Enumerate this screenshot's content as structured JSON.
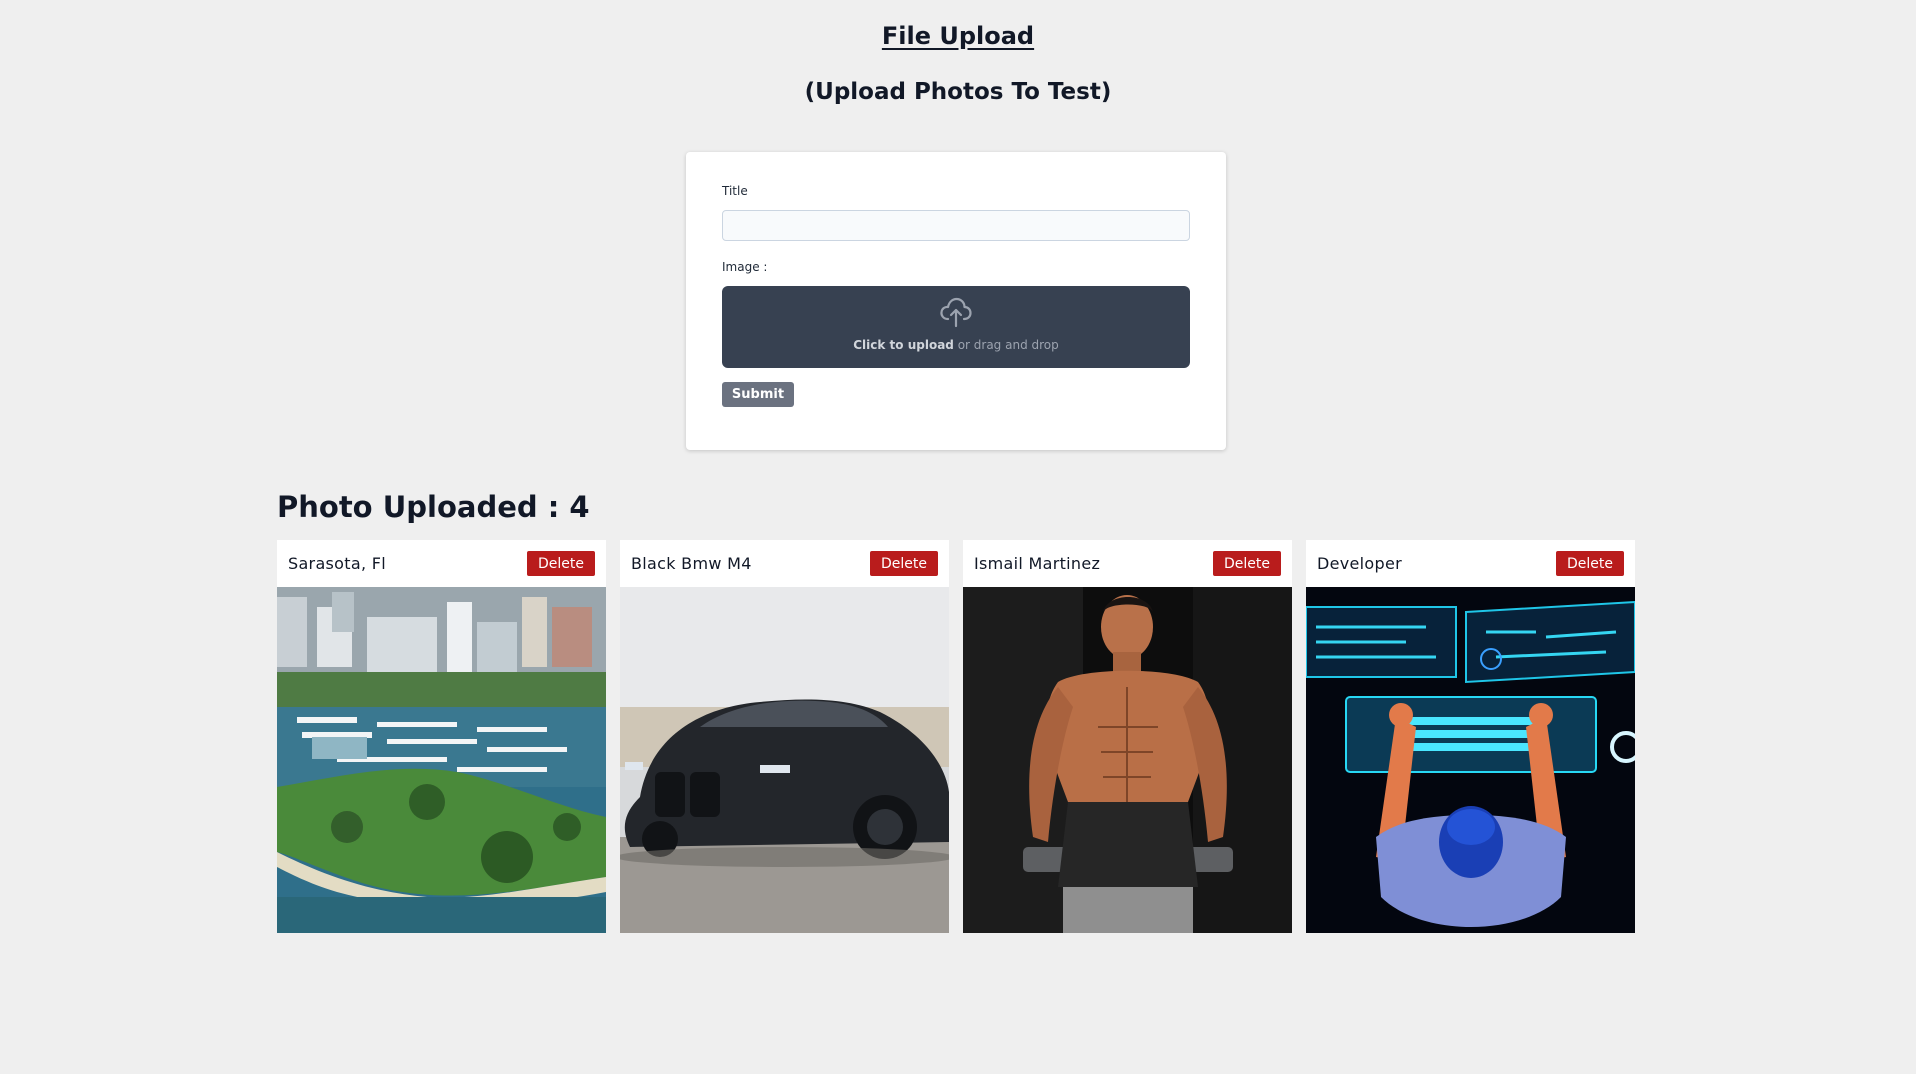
{
  "header": {
    "title": "File Upload",
    "subtitle": "(Upload Photos To Test)"
  },
  "form": {
    "title_label": "Title",
    "title_value": "",
    "title_placeholder": "",
    "image_label": "Image :",
    "dropzone_bold": "Click to upload",
    "dropzone_rest": " or drag and drop",
    "upload_icon": "cloud-upload-icon",
    "submit_label": "Submit"
  },
  "gallery": {
    "heading": "Photo Uploaded : 4",
    "delete_label": "Delete",
    "photos": [
      {
        "title": "Sarasota, Fl"
      },
      {
        "title": "Black Bmw M4"
      },
      {
        "title": "Ismail Martinez"
      },
      {
        "title": "Developer"
      }
    ]
  },
  "colors": {
    "background": "#efefef",
    "dropzone": "#374151",
    "submit": "#6b7280",
    "delete": "#b91c1c"
  }
}
